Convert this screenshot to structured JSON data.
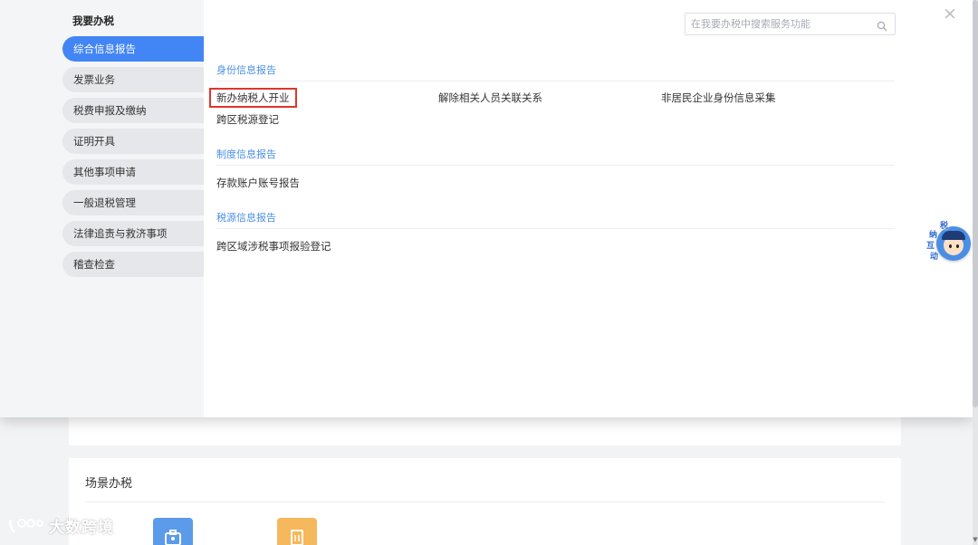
{
  "overlay": {
    "sidebar": {
      "title": "我要办税",
      "items": [
        {
          "label": "综合信息报告",
          "active": true
        },
        {
          "label": "发票业务",
          "active": false
        },
        {
          "label": "税费申报及缴纳",
          "active": false
        },
        {
          "label": "证明开具",
          "active": false
        },
        {
          "label": "其他事项申请",
          "active": false
        },
        {
          "label": "一般退税管理",
          "active": false
        },
        {
          "label": "法律追责与救济事项",
          "active": false
        },
        {
          "label": "稽查检查",
          "active": false
        }
      ]
    },
    "search": {
      "placeholder": "在我要办税中搜索服务功能",
      "value": ""
    },
    "close_label": "×",
    "sections": [
      {
        "title": "身份信息报告",
        "items": [
          "新办纳税人开业",
          "解除相关人员关联关系",
          "非居民企业身份信息采集",
          "跨区税源登记"
        ]
      },
      {
        "title": "制度信息报告",
        "items": [
          "存款账户账号报告"
        ]
      },
      {
        "title": "税源信息报告",
        "items": [
          "跨区域涉税事项报验登记"
        ]
      }
    ],
    "highlighted_item": "新办纳税人开业",
    "mascot": {
      "chars": [
        "纳",
        "税",
        "互",
        "动"
      ]
    }
  },
  "background": {
    "scene_section_title": "场景办税"
  },
  "watermark": {
    "text": "大数跨境"
  },
  "colors": {
    "accent": "#4285f4",
    "section_title": "#4a90e2",
    "highlight_border": "#e0352b"
  }
}
